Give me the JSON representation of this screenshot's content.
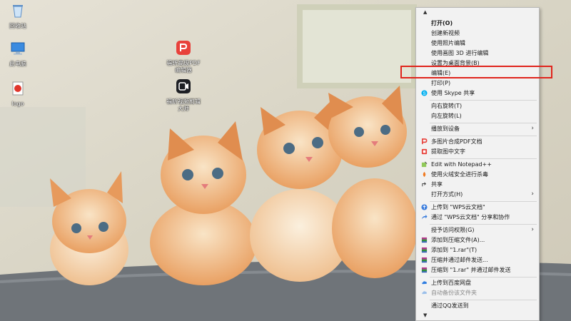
{
  "desktop": {
    "icons": [
      {
        "label": "回收站",
        "icon": "recycle-bin-icon"
      },
      {
        "label": "此电脑",
        "icon": "computer-icon"
      },
      {
        "label": "logo",
        "icon": "logo-file-icon"
      },
      {
        "label": "福昕高级PDF编辑器",
        "icon": "pdf-editor-icon"
      },
      {
        "label": "福昕视频剪辑大师",
        "icon": "video-editor-icon"
      }
    ],
    "colors": {
      "pdf_red": "#e8413b",
      "video_dark": "#1d1f24",
      "folder_blue": "#3b8be0"
    }
  },
  "context_menu": {
    "scroll_up": "▲",
    "scroll_down": "▼",
    "items": [
      {
        "label": "打开(O)",
        "bold": true
      },
      {
        "label": "创建新视频"
      },
      {
        "label": "使用照片编辑"
      },
      {
        "label": "使用画图 3D 进行编辑"
      },
      {
        "label": "设置为桌面背景(B)"
      },
      {
        "label": "编辑(E)",
        "highlighted": true
      },
      {
        "label": "打印(P)"
      },
      {
        "label": "使用 Skype 共享",
        "icon": "skype-icon"
      },
      {
        "label": "向右旋转(T)"
      },
      {
        "label": "向左旋转(L)"
      },
      {
        "label": "播放到设备",
        "submenu": true
      },
      {
        "label": "多图片合成PDF文档",
        "icon": "pdf-icon"
      },
      {
        "label": "提取图中文字",
        "icon": "ocr-icon"
      },
      {
        "label": "Edit with Notepad++",
        "icon": "notepad-plus-plus-icon"
      },
      {
        "label": "使用火绒安全进行杀毒",
        "icon": "huorong-icon"
      },
      {
        "label": "共享",
        "icon": "share-icon"
      },
      {
        "label": "打开方式(H)",
        "submenu": true
      },
      {
        "label": "上传到 \"WPS云文档\"",
        "icon": "wps-cloud-upload-icon"
      },
      {
        "label": "通过 \"WPS云文档\" 分享和协作",
        "icon": "wps-share-icon"
      },
      {
        "label": "授予访问权限(G)",
        "submenu": true
      },
      {
        "label": "添加到压缩文件(A)...",
        "icon": "winrar-icon"
      },
      {
        "label": "添加到 \"1.rar\"(T)",
        "icon": "winrar-icon"
      },
      {
        "label": "压缩并通过邮件发送...",
        "icon": "winrar-icon"
      },
      {
        "label": "压缩到 \"1.rar\" 并通过邮件发送",
        "icon": "winrar-icon"
      },
      {
        "label": "上传到百度网盘",
        "icon": "baidu-netdisk-icon"
      },
      {
        "label": "自动备份该文件夹",
        "icon": "baidu-backup-icon",
        "disabled": true
      },
      {
        "label": "通过QQ发送到"
      }
    ],
    "highlight_color": "#e0241c"
  }
}
